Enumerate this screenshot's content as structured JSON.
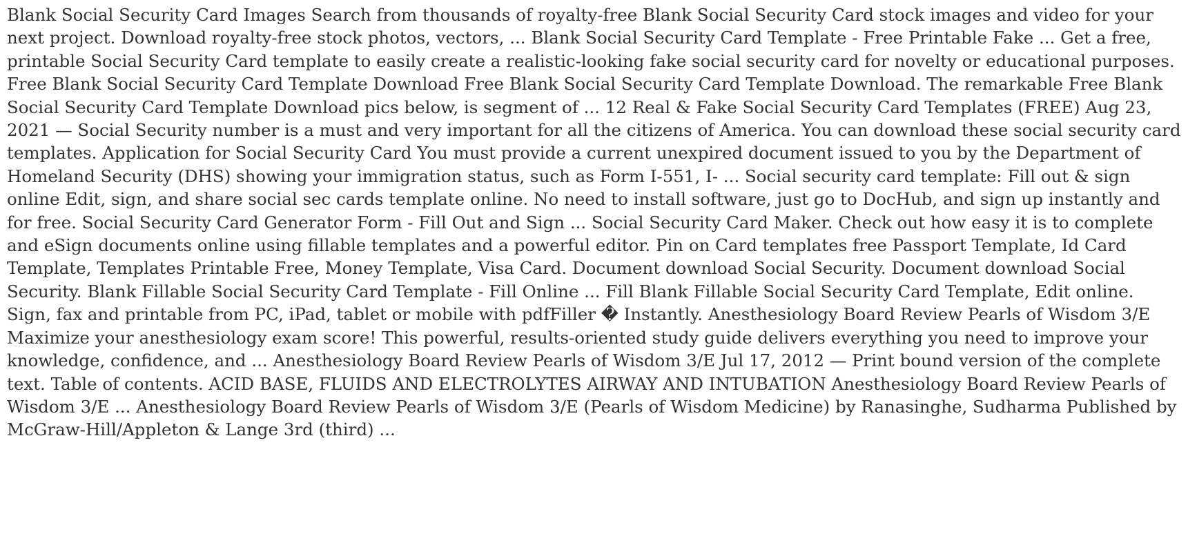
{
  "document": {
    "paragraph": "Blank Social Security Card Images Search from thousands of royalty-free Blank Social Security Card stock images and video for your next project. Download royalty-free stock photos, vectors, ... Blank Social Security Card Template - Free Printable Fake ... Get a free, printable Social Security Card template to easily create a realistic-looking fake social security card for novelty or educational purposes. Free Blank Social Security Card Template Download Free Blank Social Security Card Template Download. The remarkable Free Blank Social Security Card Template Download pics below, is segment of ... 12 Real & Fake Social Security Card Templates (FREE) Aug 23, 2021 — Social Security number is a must and very important for all the citizens of America. You can download these social security card templates. Application for Social Security Card You must provide a current unexpired document issued to you by the Department of Homeland Security (DHS) showing your immigration status, such as Form I-551, I- ... Social security card template: Fill out & sign online Edit, sign, and share social sec cards template online. No need to install software, just go to DocHub, and sign up instantly and for free. Social Security Card Generator Form - Fill Out and Sign ... Social Security Card Maker. Check out how easy it is to complete and eSign documents online using fillable templates and a powerful editor. Pin on Card templates free Passport Template, Id Card Template, Templates Printable Free, Money Template, Visa Card. Document download Social Security. Document download Social Security. Blank Fillable Social Security Card Template - Fill Online ... Fill Blank Fillable Social Security Card Template, Edit online. Sign, fax and printable from PC, iPad, tablet or mobile with pdfFiller � Instantly. Anesthesiology Board Review Pearls of Wisdom 3/E Maximize your anesthesiology exam score! This powerful, results-oriented study guide delivers everything you need to improve your knowledge, confidence, and ... Anesthesiology Board Review Pearls of Wisdom 3/E Jul 17, 2012 — Print bound version of the complete text. Table of contents. ACID BASE, FLUIDS AND ELECTROLYTES AIRWAY AND INTUBATION Anesthesiology Board Review Pearls of Wisdom 3/E ... Anesthesiology Board Review Pearls of Wisdom 3/E (Pearls of Wisdom Medicine) by Ranasinghe, Sudharma Published by McGraw-Hill/Appleton & Lange 3rd (third) ..."
  },
  "colors": {
    "text": "#333333",
    "background": "#ffffff"
  }
}
